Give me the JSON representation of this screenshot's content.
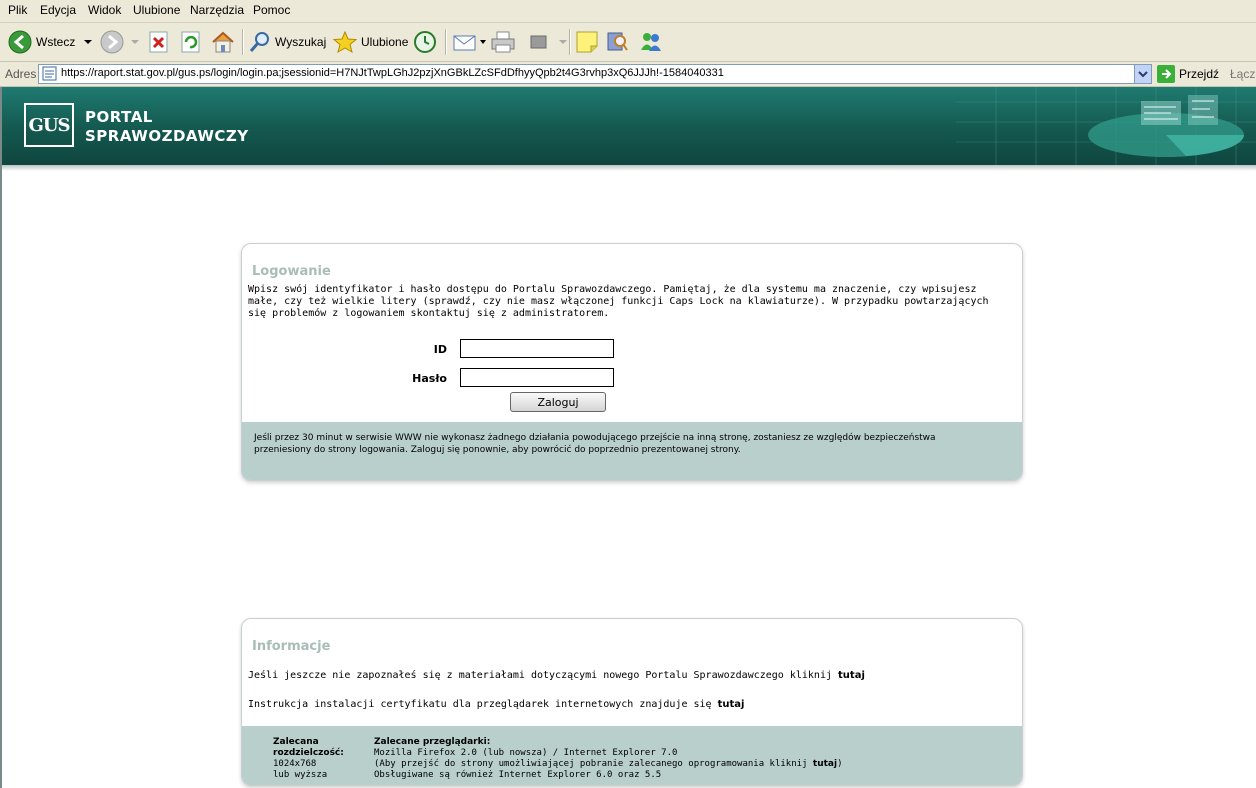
{
  "menu": [
    "Plik",
    "Edycja",
    "Widok",
    "Ulubione",
    "Narzędzia",
    "Pomoc"
  ],
  "toolbar": {
    "back_label": "Wstecz",
    "search_label": "Wyszukaj",
    "favorites_label": "Ulubione"
  },
  "address": {
    "label": "Adres",
    "url": "https://raport.stat.gov.pl/gus.ps/login/login.pa;jsessionid=H7NJtTwpLGhJ2pzjXnGBkLZcSFdDfhyyQpb2t4G3rvhp3xQ6JJJh!-1584040331",
    "go_label": "Przejdź",
    "links_label": "Łącza"
  },
  "banner": {
    "logo_text": "GUS",
    "title_line1": "PORTAL",
    "title_line2": "SPRAWOZDAWCZY"
  },
  "login": {
    "title": "Logowanie",
    "intro": "Wpisz swój identyfikator i hasło dostępu do Portalu Sprawozdawczego. Pamiętaj, że dla systemu ma znaczenie, czy wpisujesz małe, czy też wielkie litery (sprawdź, czy nie masz włączonej funkcji Caps Lock na klawiaturze). W przypadku powtarzających się problemów z logowaniem skontaktuj się z administratorem.",
    "id_label": "ID",
    "id_value": "",
    "password_label": "Hasło",
    "password_value": "",
    "submit_label": "Zaloguj",
    "timeout_note": "Jeśli przez 30 minut w serwisie WWW nie wykonasz żadnego działania powodującego przejście na inną stronę, zostaniesz ze względów bezpieczeństwa przeniesiony do strony logowania. Zaloguj się ponownie, aby powrócić do poprzednio prezentowanej strony."
  },
  "info": {
    "title": "Informacje",
    "line1_text": "Jeśli jeszcze nie zapoznałeś się z materiałami dotyczącymi nowego Portalu Sprawozdawczego kliknij",
    "line1_link": "tutaj",
    "line2_text": "Instrukcja instalacji certyfikatu dla przeglądarek internetowych znajduje się",
    "line2_link": "tutaj",
    "resolution_heading_1": "Zalecana",
    "resolution_heading_2": "rozdzielczość:",
    "resolution_value": "1024x768",
    "resolution_note": "lub wyższa",
    "browsers_heading": "Zalecane przeglądarki:",
    "browsers_line1": "Mozilla Firefox 2.0 (lub nowsza) / Internet Explorer 7.0",
    "browsers_line2_text": "(Aby przejść do strony umożliwiającej pobranie zalecanego oprogramowania kliknij",
    "browsers_line2_link": "tutaj",
    "browsers_line2_end": ")",
    "browsers_line3": "Obsługiwane są również Internet Explorer 6.0 oraz 5.5"
  },
  "colors": {
    "banner": "#14584f",
    "panel_footer": "#b8cfcb",
    "panel_title": "#a8bdb8"
  }
}
